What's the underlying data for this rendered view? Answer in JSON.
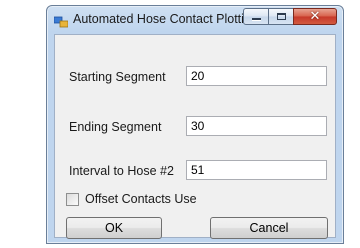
{
  "window": {
    "title": "Automated Hose Contact Plotti...",
    "close_glyph": "✕"
  },
  "form": {
    "starting_segment": {
      "label": "Starting Segment",
      "value": "20"
    },
    "ending_segment": {
      "label": "Ending Segment",
      "value": "30"
    },
    "interval_to_hose": {
      "label": "Interval to Hose #2",
      "value": "51"
    },
    "offset_contacts": {
      "label": "Offset Contacts Use",
      "checked": false
    }
  },
  "buttons": {
    "ok": "OK",
    "cancel": "Cancel"
  }
}
